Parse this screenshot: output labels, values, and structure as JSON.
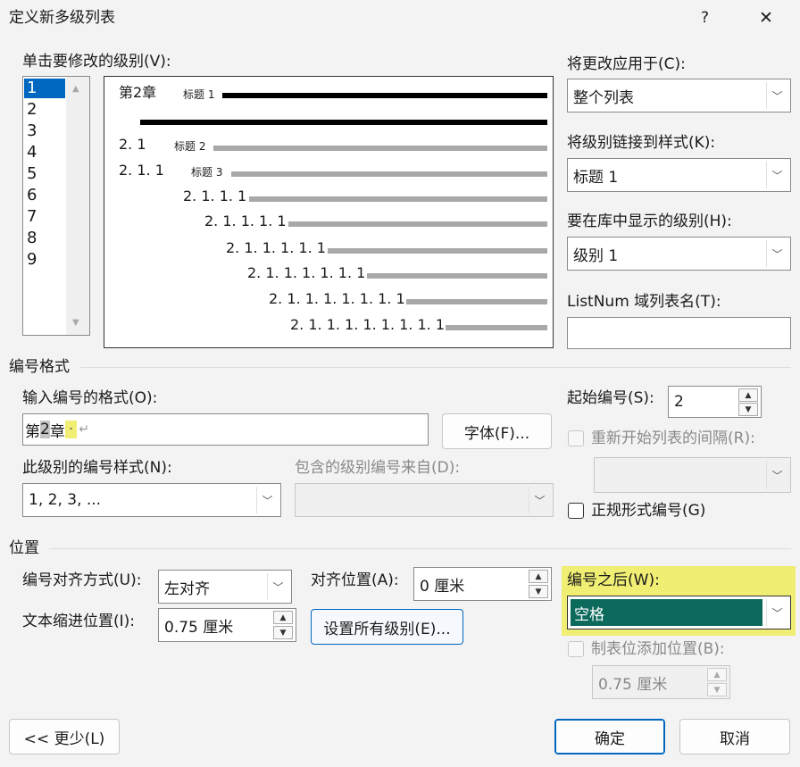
{
  "dialog": {
    "title": "定义新多级列表",
    "help": "?",
    "close": "✕"
  },
  "levels": {
    "label": "单击要修改的级别(V):",
    "items": [
      "1",
      "2",
      "3",
      "4",
      "5",
      "6",
      "7",
      "8",
      "9"
    ]
  },
  "preview": {
    "l1_num": "第2章",
    "l1_style": "标题 1",
    "l2_num": "2. 1",
    "l2_style": "标题 2",
    "l3_num": "2. 1. 1",
    "l3_style": "标题 3",
    "l4": "2. 1. 1. 1",
    "l5": "2. 1. 1. 1. 1",
    "l6": "2. 1. 1. 1. 1. 1",
    "l7": "2. 1. 1. 1. 1. 1. 1",
    "l8": "2. 1. 1. 1. 1. 1. 1. 1",
    "l9": "2. 1. 1. 1. 1. 1. 1. 1. 1"
  },
  "right": {
    "apply_label": "将更改应用于(C):",
    "apply_value": "整个列表",
    "link_label": "将级别链接到样式(K):",
    "link_value": "标题 1",
    "gallery_label": "要在库中显示的级别(H):",
    "gallery_value": "级别 1",
    "listnum_label": "ListNum 域列表名(T):",
    "listnum_value": ""
  },
  "number_format": {
    "section": "编号格式",
    "input_label": "输入编号的格式(O):",
    "input_prefix": "第",
    "input_num": "2",
    "input_suffix": "章",
    "input_tab": "·",
    "input_mark": "↵",
    "font_button": "字体(F)...",
    "style_label": "此级别的编号样式(N):",
    "style_value": "1, 2, 3, ...",
    "include_label": "包含的级别编号来自(D):",
    "include_value": "",
    "start_label": "起始编号(S):",
    "start_value": "2",
    "restart_label": "重新开始列表的间隔(R):",
    "restart_value": "",
    "legal_label": "正规形式编号(G)"
  },
  "position": {
    "section": "位置",
    "align_label": "编号对齐方式(U):",
    "align_value": "左对齐",
    "align_at_label": "对齐位置(A):",
    "align_at_value": "0 厘米",
    "indent_label": "文本缩进位置(I):",
    "indent_value": "0.75 厘米",
    "set_all_button": "设置所有级别(E)...",
    "follow_label": "编号之后(W):",
    "follow_value": "空格",
    "tab_label": "制表位添加位置(B):",
    "tab_value": "0.75 厘米"
  },
  "footer": {
    "less_button": "<< 更少(L)",
    "ok_button": "确定",
    "cancel_button": "取消"
  },
  "colors": {
    "highlight": "#f0ee73",
    "selected": "#0b6a5c",
    "accent": "#0067c0"
  }
}
